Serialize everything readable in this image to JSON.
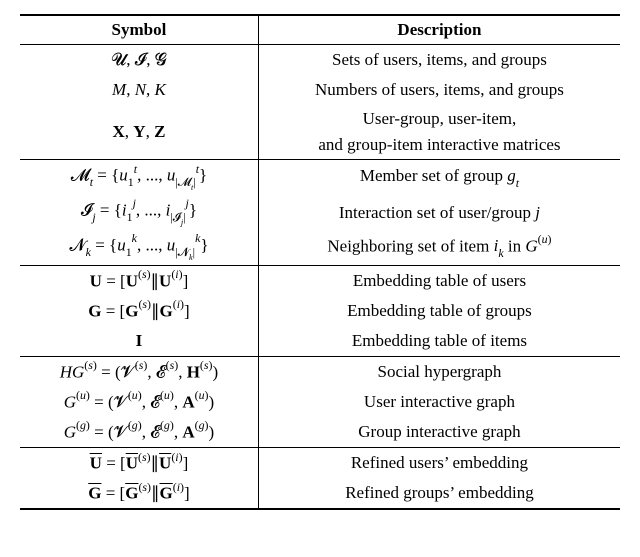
{
  "header": {
    "symbol": "Symbol",
    "description": "Description"
  },
  "sections": [
    {
      "rows": [
        {
          "sym": "𝓤, 𝓘, 𝓖",
          "desc": "Sets of users, items, and groups"
        },
        {
          "sym": "<span class='sym'>M</span>, <span class='sym'>N</span>, <span class='sym'>K</span>",
          "desc": "Numbers of users, items, and groups"
        },
        {
          "sym": "<b>X</b>, <b>Y</b>, <b>Z</b>",
          "desc": "User-group, user-item,<br>and group-item interactive matrices"
        }
      ]
    },
    {
      "rows": [
        {
          "sym": "𝓜<span class='sub'><span class='sym'>t</span></span> = {<span class='sym'>u</span><span class='sub'>1</span><span class='sup'><span class='sym'>t</span></span>, ..., <span class='sym'>u</span><span class='sub'>|𝓜<span class='sub'><span class='sym'>t</span></span>|</span><span class='sup'><span class='sym'>t</span></span>}",
          "desc": "Member set of group <span class='sym'>g<span class='sub'>t</span></span>"
        },
        {
          "sym": "𝓘<span class='sub'><span class='sym'>j</span></span> = {<span class='sym'>i</span><span class='sub'>1</span><span class='sup'><span class='sym'>j</span></span>, ..., <span class='sym'>i</span><span class='sub'>|𝓘<span class='sub'><span class='sym'>j</span></span>|</span><span class='sup'><span class='sym'>j</span></span>}",
          "desc": "Interaction set of user/group <span class='sym'>j</span>"
        },
        {
          "sym": "𝓝<span class='sub'><span class='sym'>k</span></span> = {<span class='sym'>u</span><span class='sub'>1</span><span class='sup'><span class='sym'>k</span></span>, ..., <span class='sym'>u</span><span class='sub'>|𝓝<span class='sub'><span class='sym'>k</span></span>|</span><span class='sup'><span class='sym'>k</span></span>}",
          "desc": "Neighboring set of item <span class='sym'>i<span class='sub'>k</span></span> in <span class='sym'>G</span><span class='sup'>(<span class='sym'>u</span>)</span>"
        }
      ]
    },
    {
      "rows": [
        {
          "sym": "<b>U</b> = [<b>U</b><span class='sup'>(<span class='sym'>s</span>)</span>∥<b>U</b><span class='sup'>(<span class='sym'>i</span>)</span>]",
          "desc": "Embedding table of users"
        },
        {
          "sym": "<b>G</b> = [<b>G</b><span class='sup'>(<span class='sym'>s</span>)</span>∥<b>G</b><span class='sup'>(<span class='sym'>i</span>)</span>]",
          "desc": "Embedding table of groups"
        },
        {
          "sym": "<b>I</b>",
          "desc": "Embedding table of items"
        }
      ]
    },
    {
      "rows": [
        {
          "sym": "<span class='sym'>HG</span><span class='sup'>(<span class='sym'>s</span>)</span> = (𝓥<span class='sup'>(<span class='sym'>s</span>)</span>, 𝓔<span class='sup'>(<span class='sym'>s</span>)</span>, <b>H</b><span class='sup'>(<span class='sym'>s</span>)</span>)",
          "desc": "Social hypergraph"
        },
        {
          "sym": "<span class='sym'>G</span><span class='sup'>(<span class='sym'>u</span>)</span> = (𝓥<span class='sup'>(<span class='sym'>u</span>)</span>, 𝓔<span class='sup'>(<span class='sym'>u</span>)</span>, <b>A</b><span class='sup'>(<span class='sym'>u</span>)</span>)",
          "desc": "User interactive graph"
        },
        {
          "sym": "<span class='sym'>G</span><span class='sup'>(<span class='sym'>g</span>)</span> = (𝓥<span class='sup'>(<span class='sym'>g</span>)</span>, 𝓔<span class='sup'>(<span class='sym'>g</span>)</span>, <b>A</b><span class='sup'>(<span class='sym'>g</span>)</span>)",
          "desc": "Group interactive graph"
        }
      ]
    },
    {
      "rows": [
        {
          "sym": "<span class='bar'><b>U</b></span> = [<span class='bar'><b>U</b></span><span class='sup'>(<span class='sym'>s</span>)</span>∥<span class='bar'><b>U</b></span><span class='sup'>(<span class='sym'>i</span>)</span>]",
          "desc": "Refined users’ embedding"
        },
        {
          "sym": "<span class='bar'><b>G</b></span> = [<span class='bar'><b>G</b></span><span class='sup'>(<span class='sym'>s</span>)</span>∥<span class='bar'><b>G</b></span><span class='sup'>(<span class='sym'>i</span>)</span>]",
          "desc": "Refined groups’ embedding"
        }
      ]
    }
  ]
}
